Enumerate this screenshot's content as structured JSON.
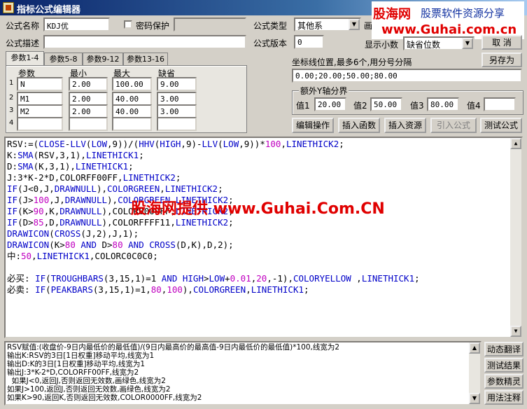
{
  "window": {
    "title": "指标公式编辑器"
  },
  "watermark": {
    "brand": "股海网",
    "slogan": "股票软件资源分享",
    "url": "www.Guhai.com.cn",
    "center": "股海网提供 www.Guhai.Com.CN"
  },
  "form": {
    "name_label": "公式名称",
    "name_value": "KDJ优",
    "pwd_label": "密码保护",
    "desc_label": "公式描述",
    "type_label": "公式类型",
    "type_value": "其他系",
    "version_label": "公式版本",
    "version_value": "0",
    "display_label": "显示小数",
    "display_value": "缺省位数",
    "draw_label": "画"
  },
  "buttons": {
    "cancel": "取 消",
    "save_as": "另存为",
    "edit_op": "编辑操作",
    "insert_fn": "插入函数",
    "insert_res": "插入资源",
    "import": "引入公式",
    "test": "测试公式",
    "dyn_translate": "动态翻译",
    "test_result": "测试结果",
    "param_wizard": "参数精灵",
    "usage": "用法注释"
  },
  "tabs": [
    "参数1-4",
    "参数5-8",
    "参数9-12",
    "参数13-16"
  ],
  "params": {
    "headers": [
      "参数",
      "最小",
      "最大",
      "缺省"
    ],
    "rows": [
      {
        "idx": "1",
        "name": "N",
        "min": "2.00",
        "max": "100.00",
        "def": "9.00"
      },
      {
        "idx": "2",
        "name": "M1",
        "min": "2.00",
        "max": "40.00",
        "def": "3.00"
      },
      {
        "idx": "3",
        "name": "M2",
        "min": "2.00",
        "max": "40.00",
        "def": "3.00"
      },
      {
        "idx": "4",
        "name": "",
        "min": "",
        "max": "",
        "def": ""
      }
    ]
  },
  "coord": {
    "label": "坐标线位置,最多6个,用分号分隔",
    "value": "0.00;20.00;50.00;80.00"
  },
  "yaxis": {
    "label": "额外Y轴分界",
    "v1_label": "值1",
    "v1": "20.00",
    "v2_label": "值2",
    "v2": "50.00",
    "v3_label": "值3",
    "v3": "80.00",
    "v4_label": "值4",
    "v4": ""
  },
  "output": [
    "RSV赋值:(收盘价-9日内最低价的最低值)/(9日内最高价的最高值-9日内最低价的最低值)*100,线宽为2",
    "输出K:RSV的3日[1日权重]移动平均,线宽为1",
    "输出D:K的3日[1日权重]移动平均,线宽为1",
    "输出J:3*K-2*D,COLORFF00FF,线宽为2",
    "  如果J<0,返回J,否则返回无效数,画绿色,线宽为2",
    "如果J>100,返回J,否则返回无效数,画绿色,线宽为2",
    "如果K>90,返回K,否则返回无效数,COLOR0000FF,线宽为2"
  ]
}
